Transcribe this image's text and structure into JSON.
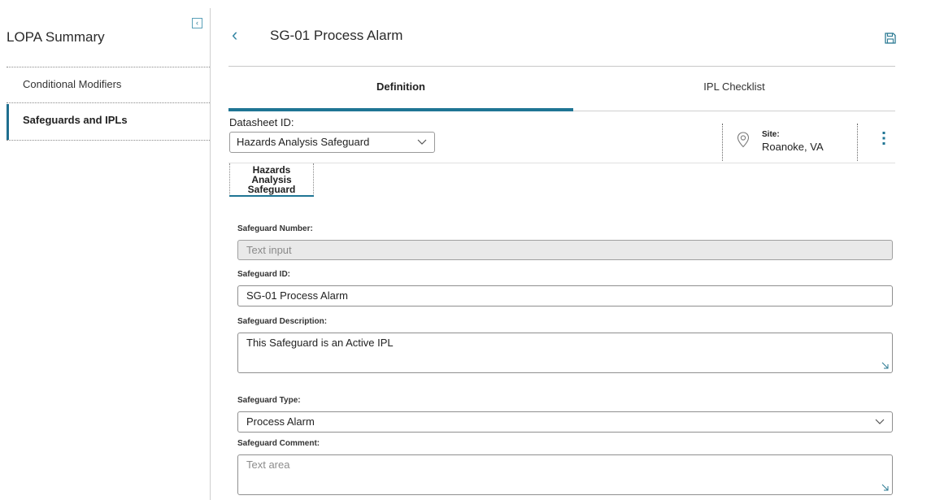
{
  "sidebar": {
    "title": "LOPA Summary",
    "collapse_glyph": "‹",
    "items": [
      {
        "label": "Conditional Modifiers"
      },
      {
        "label": "Safeguards and IPLs",
        "active": true
      }
    ]
  },
  "header": {
    "back_glyph": "‹",
    "title": "SG-01 Process Alarm"
  },
  "tabs": [
    {
      "label": "Definition",
      "active": true
    },
    {
      "label": "IPL Checklist"
    }
  ],
  "datasheet": {
    "label": "Datasheet ID:",
    "selected": "Hazards Analysis Safeguard"
  },
  "site": {
    "label": "Site:",
    "value": "Roanoke, VA"
  },
  "section_tab": {
    "line1": "Hazards",
    "line2": "Analysis",
    "line3": "Safeguard"
  },
  "form": {
    "safeguard_number": {
      "label": "Safeguard Number:",
      "placeholder": "Text input"
    },
    "safeguard_id": {
      "label": "Safeguard ID:",
      "value": "SG-01 Process Alarm"
    },
    "safeguard_description": {
      "label": "Safeguard Description:",
      "value": "This Safeguard is an Active IPL"
    },
    "safeguard_type": {
      "label": "Safeguard Type:",
      "value": "Process Alarm"
    },
    "safeguard_comment": {
      "label": "Safeguard Comment:",
      "placeholder": "Text area"
    }
  },
  "colors": {
    "accent": "#1f7594",
    "link": "#3a89a6"
  }
}
